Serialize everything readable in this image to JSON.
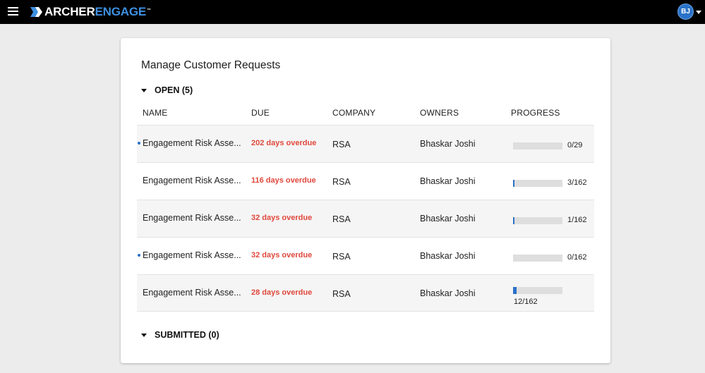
{
  "header": {
    "logo_part1": "ARCHER",
    "logo_part2": "ENGAGE",
    "logo_tm": "™",
    "user_initials": "BJ"
  },
  "page": {
    "title": "Manage Customer Requests"
  },
  "sections": {
    "open_label": "OPEN (5)",
    "submitted_label": "SUBMITTED (0)"
  },
  "columns": [
    "NAME",
    "DUE",
    "COMPANY",
    "OWNERS",
    "PROGRESS"
  ],
  "rows": [
    {
      "name": "Engagement Risk Asse...",
      "due": "202 days overdue",
      "company": "RSA",
      "owner": "Bhaskar Joshi",
      "progress": "0/29",
      "fraction": 0.0,
      "unread": true
    },
    {
      "name": "Engagement Risk Asse...",
      "due": "116 days overdue",
      "company": "RSA",
      "owner": "Bhaskar Joshi",
      "progress": "3/162",
      "fraction": 0.0185,
      "unread": false
    },
    {
      "name": "Engagement Risk Asse...",
      "due": "32 days overdue",
      "company": "RSA",
      "owner": "Bhaskar Joshi",
      "progress": "1/162",
      "fraction": 0.0062,
      "unread": false
    },
    {
      "name": "Engagement Risk Asse...",
      "due": "32 days overdue",
      "company": "RSA",
      "owner": "Bhaskar Joshi",
      "progress": "0/162",
      "fraction": 0.0,
      "unread": true
    },
    {
      "name": "Engagement Risk Asse...",
      "due": "28 days overdue",
      "company": "RSA",
      "owner": "Bhaskar Joshi",
      "progress": "12/162",
      "fraction": 0.074,
      "unread": false
    }
  ],
  "colors": {
    "accent": "#2a72c9",
    "overdue": "#e0483c"
  }
}
